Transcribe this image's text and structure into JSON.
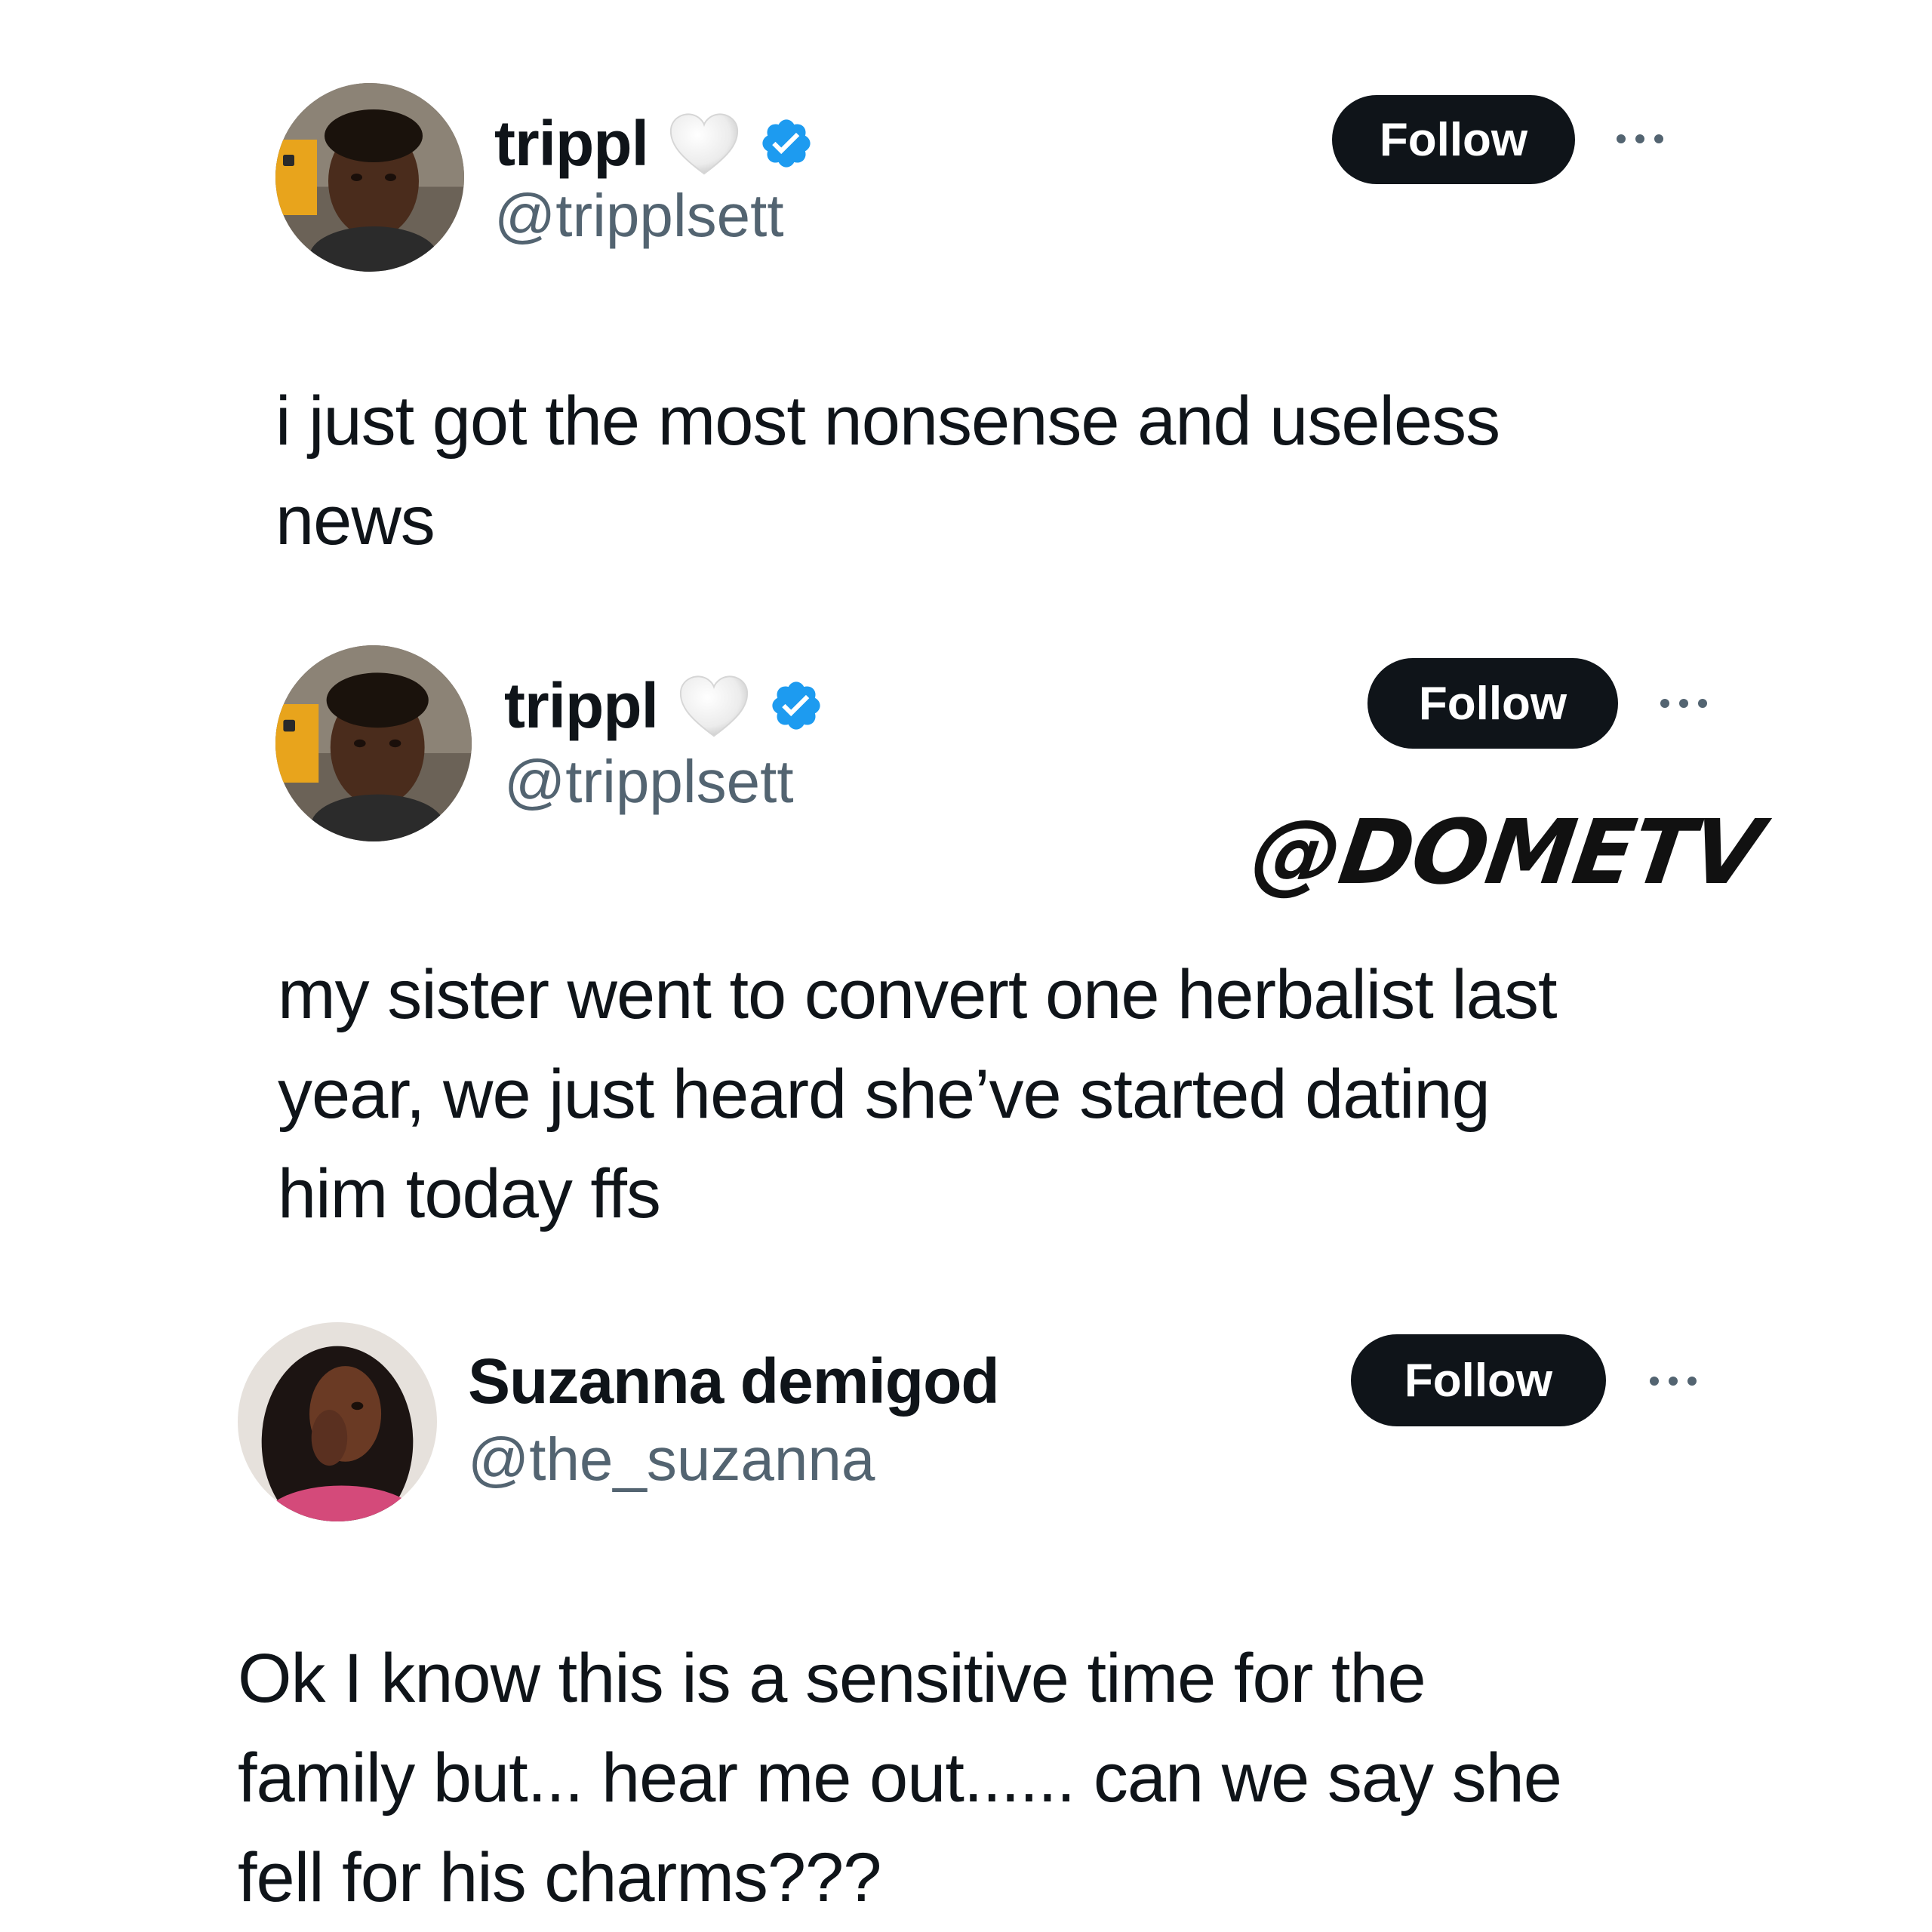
{
  "tweets": [
    {
      "display_name": "trippl",
      "handle": "@tripplsett",
      "verified": true,
      "name_emoji": "white-heart-icon",
      "follow_label": "Follow",
      "text": "i just got the most nonsense and useless\nnews"
    },
    {
      "display_name": "trippl",
      "handle": "@tripplsett",
      "verified": true,
      "name_emoji": "white-heart-icon",
      "follow_label": "Follow",
      "text": "my sister went to convert one herbalist last\nyear, we just heard she’ve started dating\nhim today ffs"
    },
    {
      "display_name": "Suzanna demigod",
      "handle": "@the_suzanna",
      "verified": false,
      "follow_label": "Follow",
      "text": "Ok I know this is a sensitive time for the\nfamily but... hear me out...... can we say she\nfell for his charms???"
    }
  ],
  "watermark": "@DOMETV",
  "colors": {
    "background": "#ffffff",
    "text": "#0f1419",
    "handle": "#536471",
    "follow_button": "#0f1419",
    "verified_badge": "#1d9bf0"
  }
}
